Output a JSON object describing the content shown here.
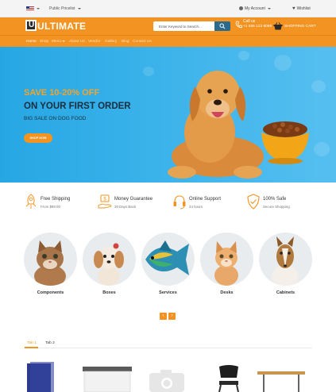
{
  "topbar": {
    "price_list": "Public Pricelist",
    "my_account": "My Account",
    "wishlist": "Wishlist"
  },
  "header": {
    "logo_text": "ULTIMATE",
    "search_placeholder": "Enter Keyword to Search...",
    "call_label": "Call us",
    "call_number": "+1 555 123 8069",
    "cart_label": "SHOPPING CART"
  },
  "nav": {
    "items": [
      "Home",
      "Shop",
      "Menu",
      "About Us",
      "Vendor",
      "Gallery",
      "Blog",
      "Contact Us"
    ]
  },
  "hero": {
    "line1": "SAVE 10-20% OFF",
    "line2": "ON YOUR FIRST ORDER",
    "line3": "BIG SALE ON DOG FOOD",
    "button": "SHOP NOW"
  },
  "features": [
    {
      "title": "Free Shipping",
      "subtitle": "From $99.00",
      "icon": "rocket-icon"
    },
    {
      "title": "Money Guarantee",
      "subtitle": "30 Days Back",
      "icon": "money-hand-icon"
    },
    {
      "title": "Online Support",
      "subtitle": "24 hours",
      "icon": "headset-icon"
    },
    {
      "title": "100% Safe",
      "subtitle": "Secure Shopping",
      "icon": "shield-check-icon"
    }
  ],
  "categories": [
    {
      "label": "Components",
      "image": "kitten"
    },
    {
      "label": "Boxes",
      "image": "puppy"
    },
    {
      "label": "Services",
      "image": "fish"
    },
    {
      "label": "Desks",
      "image": "ginger-kitten"
    },
    {
      "label": "Cabinets",
      "image": "collie"
    }
  ],
  "carousel": {
    "prev": "‹",
    "next": "›"
  },
  "tabs": [
    "Tab 1",
    "Tab 2"
  ],
  "colors": {
    "accent": "#f39321",
    "hero_blue": "#34aee8",
    "dark": "#1c2d3d"
  }
}
